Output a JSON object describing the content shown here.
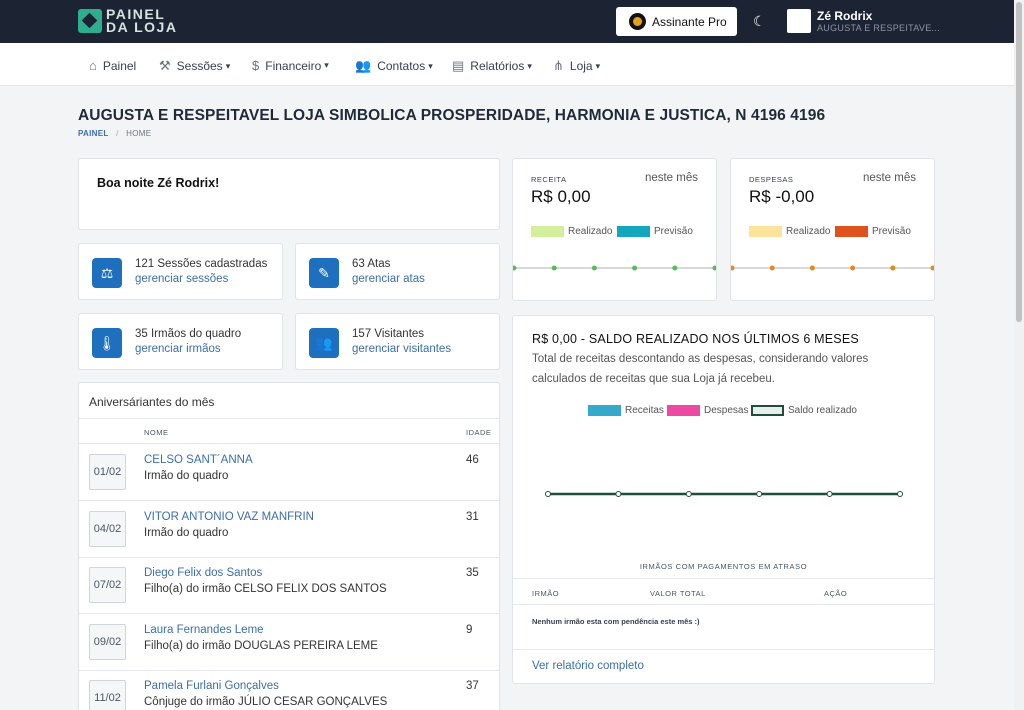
{
  "header": {
    "logo_line1": "PAINEL",
    "logo_line2": "DA LOJA",
    "pro_button": "Assinante Pro",
    "user_name": "Zé Rodrix",
    "user_org": "AUGUSTA E RESPEITAVE..."
  },
  "nav": [
    {
      "label": "Painel",
      "icon": "home-icon"
    },
    {
      "label": "Sessões",
      "icon": "gavel-icon"
    },
    {
      "label": "Financeiro",
      "icon": "dollar-icon"
    },
    {
      "label": "Contatos",
      "icon": "users-icon"
    },
    {
      "label": "Relatórios",
      "icon": "report-icon"
    },
    {
      "label": "Loja",
      "icon": "network-icon"
    }
  ],
  "page": {
    "title": "AUGUSTA E RESPEITAVEL LOJA SIMBOLICA PROSPERIDADE, HARMONIA E JUSTICA, N 4196 4196",
    "breadcrumb": [
      "PAINEL",
      "HOME"
    ]
  },
  "greeting": "Boa noite Zé Rodrix!",
  "stats": [
    {
      "count": "121 Sessões cadastradas",
      "link": "gerenciar sessões",
      "icon": "gavel-icon"
    },
    {
      "count": "63 Atas",
      "link": "gerenciar atas",
      "icon": "pen-icon"
    },
    {
      "count": "35 Irmãos do quadro",
      "link": "gerenciar irmãos",
      "icon": "thermometer-icon"
    },
    {
      "count": "157 Visitantes",
      "link": "gerenciar visitantes",
      "icon": "visitors-icon"
    }
  ],
  "birthdays": {
    "title": "Aniversáriantes do mês",
    "col_name": "NOME",
    "col_age": "IDADE",
    "rows": [
      {
        "date": "01/02",
        "name": "CELSO SANT´ANNA",
        "relation": "Irmão do quadro",
        "age": "46"
      },
      {
        "date": "04/02",
        "name": "VITOR ANTONIO VAZ MANFRIN",
        "relation": "Irmão do quadro",
        "age": "31"
      },
      {
        "date": "07/02",
        "name": "Diego Felix dos Santos",
        "relation": "Filho(a) do irmão CELSO FELIX DOS SANTOS",
        "age": "35"
      },
      {
        "date": "09/02",
        "name": "Laura Fernandes Leme",
        "relation": "Filho(a) do irmão DOUGLAS PEREIRA LEME",
        "age": "9"
      },
      {
        "date": "11/02",
        "name": "Pamela Furlani Gonçalves",
        "relation": "Cônjuge do irmão JÚLIO CESAR GONÇALVES",
        "age": "37"
      }
    ]
  },
  "receita": {
    "label": "RECEITA",
    "period": "neste mês",
    "value": "R$ 0,00",
    "legend": [
      "Realizado",
      "Previsão"
    ],
    "colors": [
      "#d4ef9c",
      "#12a7bd"
    ],
    "line_color": "#5cb85c",
    "points": [
      0,
      0,
      0,
      0,
      0,
      0
    ]
  },
  "despesas": {
    "label": "DESPESAS",
    "period": "neste mês",
    "value": "R$ -0,00",
    "legend": [
      "Realizado",
      "Previsão"
    ],
    "colors": [
      "#fbe39c",
      "#e0521c"
    ],
    "line_color": "#e08a1c",
    "points": [
      0,
      0,
      0,
      0,
      0,
      0
    ]
  },
  "saldo": {
    "title": "R$ 0,00 - SALDO REALIZADO NOS ÚLTIMOS 6 MESES",
    "description": "Total de receitas descontando as despesas, considerando valores calculados de receitas que sua Loja já recebeu.",
    "legend": [
      "Receitas",
      "Despesas",
      "Saldo realizado"
    ],
    "colors": [
      "#35a9c9",
      "#ec4aa0",
      "#1e4d3f"
    ],
    "values": [
      0,
      0,
      0,
      0,
      0,
      0
    ],
    "atraso_title": "IRMÃOS COM PAGAMENTOS EM ATRASO",
    "col_irmao": "IRMÃO",
    "col_valor": "VALOR TOTAL",
    "col_acao": "AÇÃO",
    "empty_msg": "Nenhum irmão esta com pendência este mês :)",
    "report_link": "Ver relatório completo"
  }
}
